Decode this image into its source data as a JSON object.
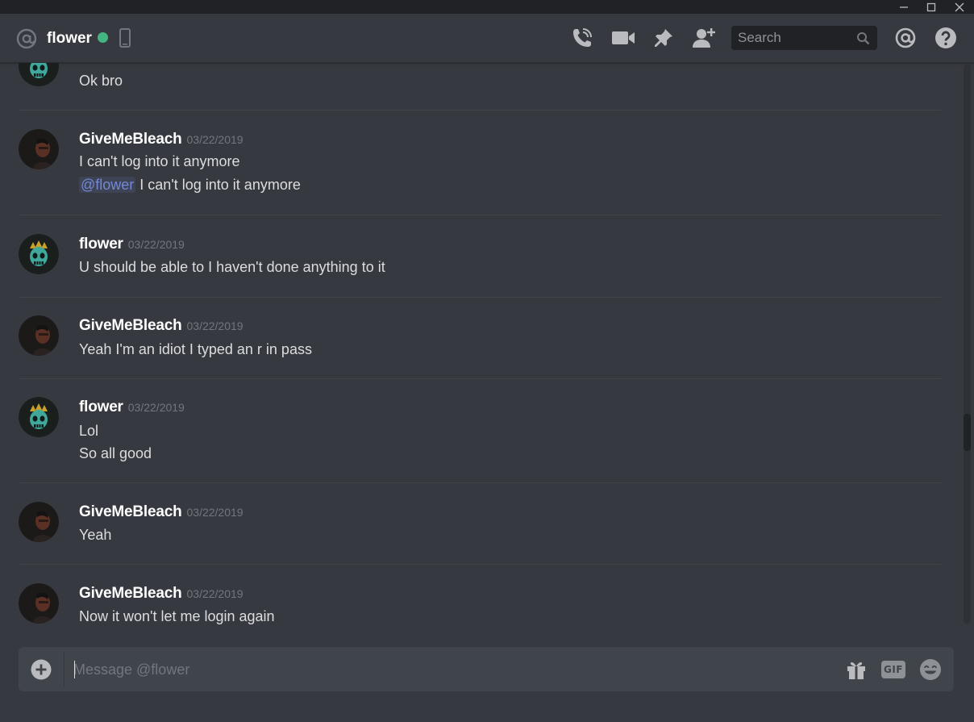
{
  "header": {
    "channel_name": "flower",
    "status_color": "#43b581",
    "search_placeholder": "Search",
    "icons": [
      "at-icon",
      "mobile-icon",
      "call-icon",
      "video-icon",
      "pin-icon",
      "add-friend-icon",
      "search-icon",
      "mention-icon",
      "help-icon"
    ]
  },
  "window_controls": [
    "minimize-icon",
    "maximize-icon",
    "close-icon"
  ],
  "messages": [
    {
      "author": "",
      "timestamp": "",
      "lines": [
        "Ok bro"
      ],
      "avatar": "skull"
    },
    {
      "author": "GiveMeBleach",
      "timestamp": "03/22/2019",
      "lines": [
        "I can't log into it anymore"
      ],
      "mention_line": {
        "mention": "@flower",
        "text": " I can't log into it anymore"
      },
      "avatar": "person"
    },
    {
      "author": "flower",
      "timestamp": "03/22/2019",
      "lines": [
        "U should be able to I haven't done anything to it"
      ],
      "avatar": "skull"
    },
    {
      "author": "GiveMeBleach",
      "timestamp": "03/22/2019",
      "lines": [
        "Yeah I'm an idiot I typed an r in pass"
      ],
      "avatar": "person"
    },
    {
      "author": "flower",
      "timestamp": "03/22/2019",
      "lines": [
        "Lol",
        "So all good"
      ],
      "avatar": "skull"
    },
    {
      "author": "GiveMeBleach",
      "timestamp": "03/22/2019",
      "lines": [
        "Yeah"
      ],
      "avatar": "person"
    },
    {
      "author": "GiveMeBleach",
      "timestamp": "03/22/2019",
      "lines": [
        "Now it won't let me login again"
      ],
      "avatar": "person"
    }
  ],
  "composer": {
    "placeholder": "Message @flower",
    "value": "",
    "gif_label": "GIF",
    "icons": [
      "add-file-icon",
      "gift-icon",
      "gif-icon",
      "emoji-icon"
    ]
  },
  "colors": {
    "background": "#36393f",
    "mention": "#7289da",
    "online": "#43b581"
  }
}
